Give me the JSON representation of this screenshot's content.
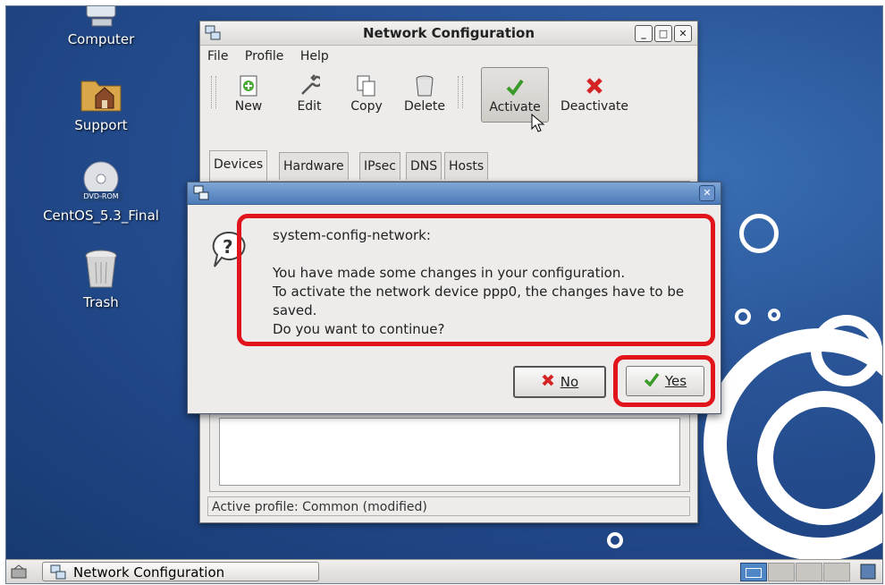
{
  "desktop": {
    "icons": [
      {
        "label": "Computer"
      },
      {
        "label": "Support"
      },
      {
        "label": "CentOS_5.3_Final",
        "disc_text": "DVD-ROM"
      },
      {
        "label": "Trash"
      }
    ]
  },
  "main_window": {
    "title": "Network Configuration",
    "menu": [
      "File",
      "Profile",
      "Help"
    ],
    "toolbar": {
      "new": "New",
      "edit": "Edit",
      "copy": "Copy",
      "delete": "Delete",
      "activate": "Activate",
      "deactivate": "Deactivate"
    },
    "tabs": [
      "Devices",
      "Hardware",
      "IPsec",
      "DNS",
      "Hosts"
    ],
    "status": "Active profile: Common (modified)"
  },
  "dialog": {
    "app_name": "system-config-network:",
    "line1": "You have made some changes in your configuration.",
    "line2": "To activate the network device ppp0, the changes have to be",
    "line3": "saved.",
    "line4": "Do you want to continue?",
    "no_label": "No",
    "yes_label": "Yes"
  },
  "taskbar": {
    "task_label": "Network Configuration"
  },
  "colors": {
    "highlight": "#e0141a",
    "desktop_blue": "#2a5598"
  }
}
